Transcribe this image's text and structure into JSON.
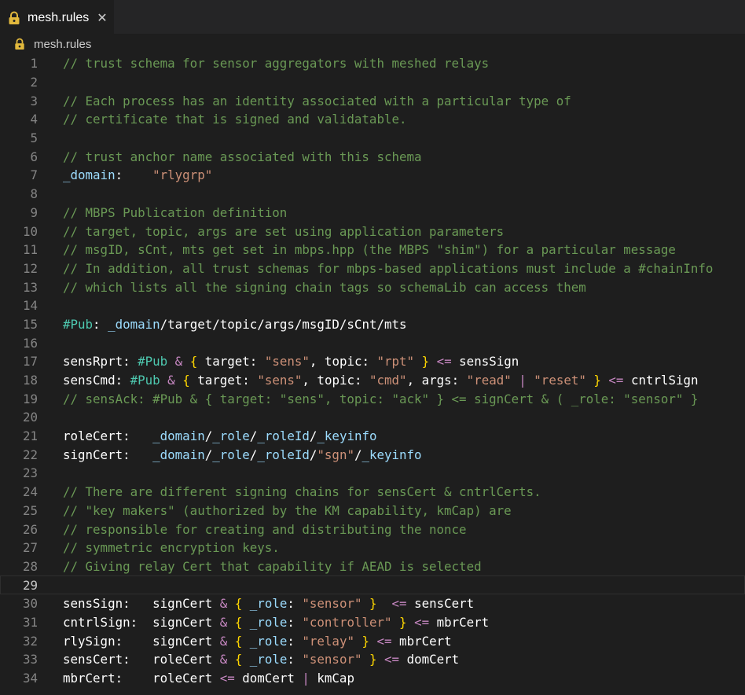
{
  "tab": {
    "label": "mesh.rules",
    "close_glyph": "✕",
    "icon": "lock-icon"
  },
  "breadcrumb": {
    "label": "mesh.rules",
    "icon": "lock-icon"
  },
  "current_line": 29,
  "lines": [
    {
      "n": "1",
      "toks": [
        [
          "c",
          "// trust schema for sensor aggregators with meshed relays"
        ]
      ]
    },
    {
      "n": "2",
      "toks": []
    },
    {
      "n": "3",
      "toks": [
        [
          "c",
          "// Each process has an identity associated with a particular type of"
        ]
      ]
    },
    {
      "n": "4",
      "toks": [
        [
          "c",
          "// certificate that is signed and validatable."
        ]
      ]
    },
    {
      "n": "5",
      "toks": []
    },
    {
      "n": "6",
      "toks": [
        [
          "c",
          "// trust anchor name associated with this schema"
        ]
      ]
    },
    {
      "n": "7",
      "toks": [
        [
          "s",
          "_domain"
        ],
        [
          "k",
          ":    "
        ],
        [
          "t",
          "\"rlygrp\""
        ]
      ]
    },
    {
      "n": "8",
      "toks": []
    },
    {
      "n": "9",
      "toks": [
        [
          "c",
          "// MBPS Publication definition"
        ]
      ]
    },
    {
      "n": "10",
      "toks": [
        [
          "c",
          "// target, topic, args are set using application parameters"
        ]
      ]
    },
    {
      "n": "11",
      "toks": [
        [
          "c",
          "// msgID, sCnt, mts get set in mbps.hpp (the MBPS \"shim\") for a particular message"
        ]
      ]
    },
    {
      "n": "12",
      "toks": [
        [
          "c",
          "// In addition, all trust schemas for mbps-based applications must include a #chainInfo"
        ]
      ]
    },
    {
      "n": "13",
      "toks": [
        [
          "c",
          "// which lists all the signing chain tags so schemaLib can access them"
        ]
      ]
    },
    {
      "n": "14",
      "toks": []
    },
    {
      "n": "15",
      "toks": [
        [
          "h",
          "#Pub"
        ],
        [
          "k",
          ": "
        ],
        [
          "s",
          "_domain"
        ],
        [
          "k",
          "/target/topic/args/msgID/sCnt/mts"
        ]
      ]
    },
    {
      "n": "16",
      "toks": []
    },
    {
      "n": "17",
      "toks": [
        [
          "k",
          "sensRprt: "
        ],
        [
          "h",
          "#Pub"
        ],
        [
          "k",
          " "
        ],
        [
          "o",
          "&"
        ],
        [
          "k",
          " "
        ],
        [
          "b",
          "{"
        ],
        [
          "k",
          " target: "
        ],
        [
          "t",
          "\"sens\""
        ],
        [
          "k",
          ", topic: "
        ],
        [
          "t",
          "\"rpt\""
        ],
        [
          "k",
          " "
        ],
        [
          "b",
          "}"
        ],
        [
          "k",
          " "
        ],
        [
          "o",
          "<="
        ],
        [
          "k",
          " sensSign"
        ]
      ]
    },
    {
      "n": "18",
      "toks": [
        [
          "k",
          "sensCmd: "
        ],
        [
          "h",
          "#Pub"
        ],
        [
          "k",
          " "
        ],
        [
          "o",
          "&"
        ],
        [
          "k",
          " "
        ],
        [
          "b",
          "{"
        ],
        [
          "k",
          " target: "
        ],
        [
          "t",
          "\"sens\""
        ],
        [
          "k",
          ", topic: "
        ],
        [
          "t",
          "\"cmd\""
        ],
        [
          "k",
          ", args: "
        ],
        [
          "t",
          "\"read\""
        ],
        [
          "k",
          " "
        ],
        [
          "o",
          "|"
        ],
        [
          "k",
          " "
        ],
        [
          "t",
          "\"reset\""
        ],
        [
          "k",
          " "
        ],
        [
          "b",
          "}"
        ],
        [
          "k",
          " "
        ],
        [
          "o",
          "<="
        ],
        [
          "k",
          " cntrlSign"
        ]
      ]
    },
    {
      "n": "19",
      "toks": [
        [
          "c",
          "// sensAck: #Pub & { target: \"sens\", topic: \"ack\" } <= signCert & ( _role: \"sensor\" }"
        ]
      ]
    },
    {
      "n": "20",
      "toks": []
    },
    {
      "n": "21",
      "toks": [
        [
          "k",
          "roleCert:   "
        ],
        [
          "s",
          "_domain"
        ],
        [
          "k",
          "/"
        ],
        [
          "s",
          "_role"
        ],
        [
          "k",
          "/"
        ],
        [
          "s",
          "_roleId"
        ],
        [
          "k",
          "/"
        ],
        [
          "s",
          "_keyinfo"
        ]
      ]
    },
    {
      "n": "22",
      "toks": [
        [
          "k",
          "signCert:   "
        ],
        [
          "s",
          "_domain"
        ],
        [
          "k",
          "/"
        ],
        [
          "s",
          "_role"
        ],
        [
          "k",
          "/"
        ],
        [
          "s",
          "_roleId"
        ],
        [
          "k",
          "/"
        ],
        [
          "t",
          "\"sgn\""
        ],
        [
          "k",
          "/"
        ],
        [
          "s",
          "_keyinfo"
        ]
      ]
    },
    {
      "n": "23",
      "toks": []
    },
    {
      "n": "24",
      "toks": [
        [
          "c",
          "// There are different signing chains for sensCert & cntrlCerts."
        ]
      ]
    },
    {
      "n": "25",
      "toks": [
        [
          "c",
          "// \"key makers\" (authorized by the KM capability, kmCap) are"
        ]
      ]
    },
    {
      "n": "26",
      "toks": [
        [
          "c",
          "// responsible for creating and distributing the nonce"
        ]
      ]
    },
    {
      "n": "27",
      "toks": [
        [
          "c",
          "// symmetric encryption keys."
        ]
      ]
    },
    {
      "n": "28",
      "toks": [
        [
          "c",
          "// Giving relay Cert that capability if AEAD is selected"
        ]
      ]
    },
    {
      "n": "29",
      "toks": []
    },
    {
      "n": "30",
      "toks": [
        [
          "k",
          "sensSign:   signCert "
        ],
        [
          "o",
          "&"
        ],
        [
          "k",
          " "
        ],
        [
          "b",
          "{"
        ],
        [
          "k",
          " "
        ],
        [
          "s",
          "_role"
        ],
        [
          "k",
          ": "
        ],
        [
          "t",
          "\"sensor\""
        ],
        [
          "k",
          " "
        ],
        [
          "b",
          "}"
        ],
        [
          "k",
          "  "
        ],
        [
          "o",
          "<="
        ],
        [
          "k",
          " sensCert"
        ]
      ]
    },
    {
      "n": "31",
      "toks": [
        [
          "k",
          "cntrlSign:  signCert "
        ],
        [
          "o",
          "&"
        ],
        [
          "k",
          " "
        ],
        [
          "b",
          "{"
        ],
        [
          "k",
          " "
        ],
        [
          "s",
          "_role"
        ],
        [
          "k",
          ": "
        ],
        [
          "t",
          "\"controller\""
        ],
        [
          "k",
          " "
        ],
        [
          "b",
          "}"
        ],
        [
          "k",
          " "
        ],
        [
          "o",
          "<="
        ],
        [
          "k",
          " mbrCert"
        ]
      ]
    },
    {
      "n": "32",
      "toks": [
        [
          "k",
          "rlySign:    signCert "
        ],
        [
          "o",
          "&"
        ],
        [
          "k",
          " "
        ],
        [
          "b",
          "{"
        ],
        [
          "k",
          " "
        ],
        [
          "s",
          "_role"
        ],
        [
          "k",
          ": "
        ],
        [
          "t",
          "\"relay\""
        ],
        [
          "k",
          " "
        ],
        [
          "b",
          "}"
        ],
        [
          "k",
          " "
        ],
        [
          "o",
          "<="
        ],
        [
          "k",
          " mbrCert"
        ]
      ]
    },
    {
      "n": "33",
      "toks": [
        [
          "k",
          "sensCert:   roleCert "
        ],
        [
          "o",
          "&"
        ],
        [
          "k",
          " "
        ],
        [
          "b",
          "{"
        ],
        [
          "k",
          " "
        ],
        [
          "s",
          "_role"
        ],
        [
          "k",
          ": "
        ],
        [
          "t",
          "\"sensor\""
        ],
        [
          "k",
          " "
        ],
        [
          "b",
          "}"
        ],
        [
          "k",
          " "
        ],
        [
          "o",
          "<="
        ],
        [
          "k",
          " domCert"
        ]
      ]
    },
    {
      "n": "34",
      "toks": [
        [
          "k",
          "mbrCert:    roleCert "
        ],
        [
          "o",
          "<="
        ],
        [
          "k",
          " domCert "
        ],
        [
          "o",
          "|"
        ],
        [
          "k",
          " kmCap"
        ]
      ]
    }
  ],
  "colors": {
    "background": "#1e1e1e",
    "comment": "#6a9955",
    "string": "#ce9178",
    "operator": "#c586c0",
    "brace": "#ffd700",
    "hash": "#4ec9b0",
    "variable": "#9cdcfe",
    "lock": "#e2b93d"
  }
}
